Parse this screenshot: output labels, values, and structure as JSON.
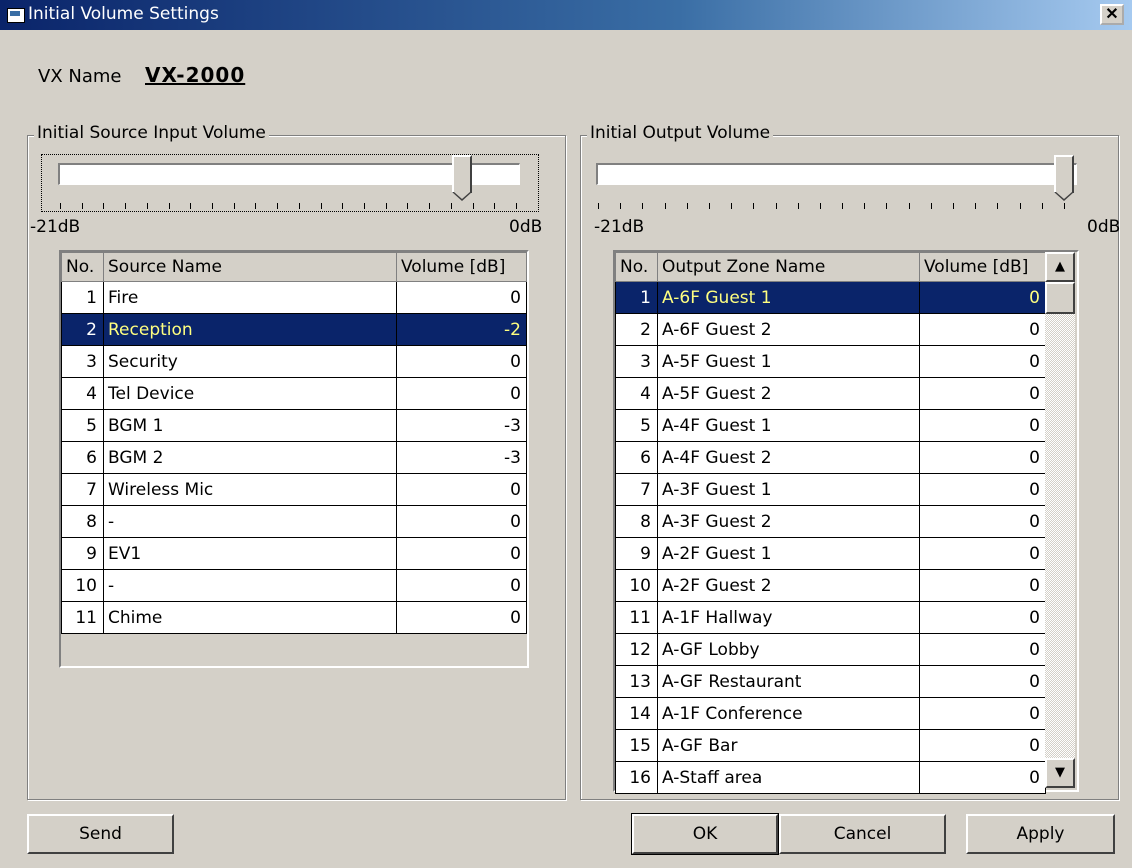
{
  "window": {
    "title": "Initial Volume Settings",
    "close_label": "✕"
  },
  "vx": {
    "label": "VX Name",
    "value": "VX-2000"
  },
  "source_group": {
    "title": "Initial Source Input Volume",
    "slider_min": "-21dB",
    "slider_max": "0dB",
    "slider_value_db": -2,
    "columns": [
      "No.",
      "Source Name",
      "Volume [dB]"
    ],
    "rows": [
      {
        "no": "1",
        "name": "Fire",
        "vol": "0"
      },
      {
        "no": "2",
        "name": "Reception",
        "vol": "-2"
      },
      {
        "no": "3",
        "name": "Security",
        "vol": "0"
      },
      {
        "no": "4",
        "name": "Tel Device",
        "vol": "0"
      },
      {
        "no": "5",
        "name": "BGM 1",
        "vol": "-3"
      },
      {
        "no": "6",
        "name": "BGM 2",
        "vol": "-3"
      },
      {
        "no": "7",
        "name": "Wireless Mic",
        "vol": "0"
      },
      {
        "no": "8",
        "name": "-",
        "vol": "0"
      },
      {
        "no": "9",
        "name": "EV1",
        "vol": "0"
      },
      {
        "no": "10",
        "name": "-",
        "vol": "0"
      },
      {
        "no": "11",
        "name": "Chime",
        "vol": "0"
      }
    ],
    "selected_row": 1
  },
  "output_group": {
    "title": "Initial Output Volume",
    "slider_min": "-21dB",
    "slider_max": "0dB",
    "slider_value_db": 0,
    "columns": [
      "No.",
      "Output Zone Name",
      "Volume [dB]"
    ],
    "rows": [
      {
        "no": "1",
        "name": "A-6F Guest 1",
        "vol": "0"
      },
      {
        "no": "2",
        "name": "A-6F Guest 2",
        "vol": "0"
      },
      {
        "no": "3",
        "name": "A-5F Guest 1",
        "vol": "0"
      },
      {
        "no": "4",
        "name": "A-5F Guest 2",
        "vol": "0"
      },
      {
        "no": "5",
        "name": "A-4F Guest 1",
        "vol": "0"
      },
      {
        "no": "6",
        "name": "A-4F Guest 2",
        "vol": "0"
      },
      {
        "no": "7",
        "name": "A-3F Guest 1",
        "vol": "0"
      },
      {
        "no": "8",
        "name": "A-3F Guest 2",
        "vol": "0"
      },
      {
        "no": "9",
        "name": "A-2F Guest 1",
        "vol": "0"
      },
      {
        "no": "10",
        "name": "A-2F Guest 2",
        "vol": "0"
      },
      {
        "no": "11",
        "name": "A-1F Hallway",
        "vol": "0"
      },
      {
        "no": "12",
        "name": "A-GF Lobby",
        "vol": "0"
      },
      {
        "no": "13",
        "name": "A-GF Restaurant",
        "vol": "0"
      },
      {
        "no": "14",
        "name": "A-1F Conference",
        "vol": "0"
      },
      {
        "no": "15",
        "name": "A-GF Bar",
        "vol": "0"
      },
      {
        "no": "16",
        "name": "A-Staff area",
        "vol": "0"
      }
    ],
    "selected_row": 0
  },
  "buttons": {
    "send": "Send",
    "ok": "OK",
    "cancel": "Cancel",
    "apply": "Apply"
  },
  "colors": {
    "selection": "#0a246a",
    "face": "#d4d0c8",
    "titlebar": "#0a246a"
  }
}
